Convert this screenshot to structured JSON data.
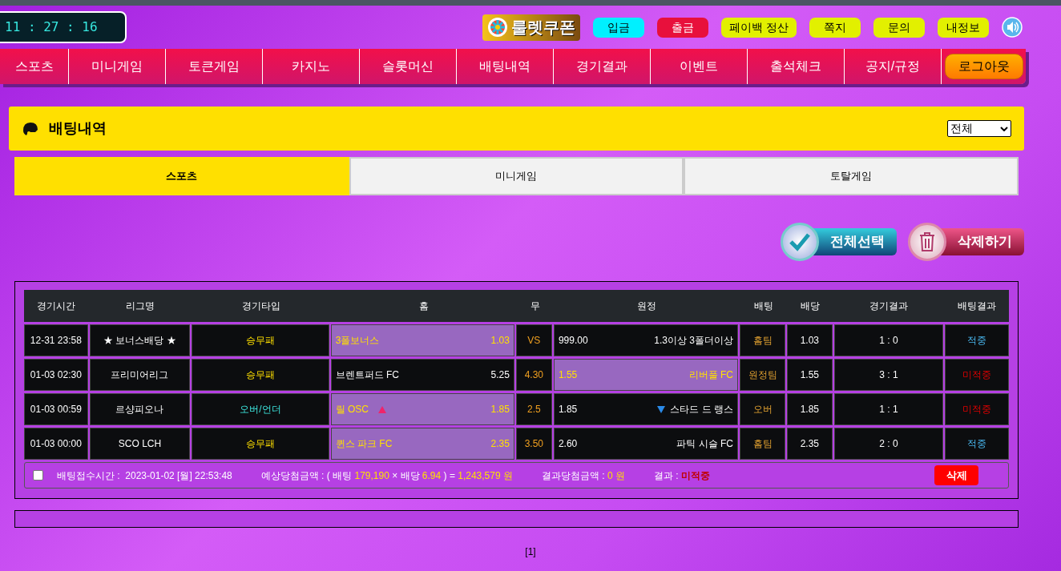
{
  "clock": "11 : 27 : 16",
  "logo": {
    "text": "룰렛쿠폰"
  },
  "top_buttons": [
    {
      "label": "입금",
      "kind": "cyan"
    },
    {
      "label": "출금",
      "kind": "red"
    },
    {
      "label": "페이백 정산",
      "kind": "lime"
    },
    {
      "label": "쪽지",
      "kind": "lime"
    },
    {
      "label": "문의",
      "kind": "lime"
    },
    {
      "label": "내정보",
      "kind": "lime"
    }
  ],
  "nav": {
    "items": [
      "스포츠",
      "미니게임",
      "토큰게임",
      "카지노",
      "슬롯머신",
      "배팅내역",
      "경기결과",
      "이벤트",
      "출석체크",
      "공지/규정"
    ],
    "logout": "로그아웃"
  },
  "section": {
    "title": "배팅내역",
    "filter": "전체"
  },
  "tabs": [
    {
      "label": "스포츠",
      "selected": true
    },
    {
      "label": "미니게임",
      "selected": false
    },
    {
      "label": "토탈게임",
      "selected": false
    }
  ],
  "actions": {
    "select_all": "전체선택",
    "delete": "삭제하기"
  },
  "table": {
    "columns": [
      "경기시간",
      "리그명",
      "경기타입",
      "홈",
      "무",
      "원정",
      "배팅",
      "배당",
      "경기결과",
      "배팅결과"
    ],
    "rows": [
      {
        "time": "12-31 23:58",
        "league": "★ 보너스배당 ★",
        "type": "승무패",
        "kind": "result",
        "home": {
          "name": "3폴보너스",
          "odds": "1.03",
          "selected": true
        },
        "draw": "VS",
        "away": {
          "odds": "999.00",
          "name": "1.3이상 3폴더이상",
          "selected": false
        },
        "bet": "홈팀",
        "rate": "1.03",
        "score": "1 : 0",
        "result": {
          "text": "적중",
          "won": true
        }
      },
      {
        "time": "01-03 02:30",
        "league": "프리미어리그",
        "type": "승무패",
        "kind": "result",
        "home": {
          "name": "브렌트퍼드 FC",
          "odds": "5.25",
          "selected": false
        },
        "draw": "4.30",
        "away": {
          "odds": "1.55",
          "name": "리버풀 FC",
          "selected": true
        },
        "bet": "원정팀",
        "rate": "1.55",
        "score": "3 : 1",
        "result": {
          "text": "미적중",
          "won": false
        }
      },
      {
        "time": "01-03 00:59",
        "league": "르샹피오나",
        "type": "오버/언더",
        "kind": "over_under",
        "home": {
          "name": "릴 OSC",
          "odds": "1.85",
          "selected": true,
          "kind": "up"
        },
        "draw": "2.5",
        "away": {
          "odds": "1.85",
          "name": "스타드 드 랭스",
          "selected": false,
          "kind": "down"
        },
        "bet": "오버",
        "rate": "1.85",
        "score": "1 : 1",
        "result": {
          "text": "미적중",
          "won": false
        }
      },
      {
        "time": "01-03 00:00",
        "league": "SCO LCH",
        "type": "승무패",
        "kind": "result",
        "home": {
          "name": "퀸스 파크 FC",
          "odds": "2.35",
          "selected": true
        },
        "draw": "3.50",
        "away": {
          "odds": "2.60",
          "name": "파틱 시슬 FC",
          "selected": false
        },
        "bet": "홈팀",
        "rate": "2.35",
        "score": "2 : 0",
        "result": {
          "text": "적중",
          "won": true
        }
      }
    ]
  },
  "summary": {
    "checked": false,
    "groups": [
      [
        {
          "text": "배팅접수시간 :  ",
          "kind": "label"
        },
        {
          "text": "2023-01-02 [월] 22:53:48",
          "kind": "value"
        }
      ],
      [
        {
          "text": "예상당첨금액 : ( 배팅 ",
          "kind": "label"
        },
        {
          "text": "179,190",
          "kind": "highlight"
        },
        {
          "text": " × 배당 ",
          "kind": "label"
        },
        {
          "text": "6.94",
          "kind": "highlight"
        },
        {
          "text": " ) = ",
          "kind": "label"
        },
        {
          "text": "1,243,579 원",
          "kind": "highlight"
        }
      ],
      [
        {
          "text": "결과당첨금액 : ",
          "kind": "label"
        },
        {
          "text": "0 원",
          "kind": "highlight"
        }
      ],
      [
        {
          "text": "결과 : ",
          "kind": "label"
        },
        {
          "text": "미적중",
          "kind": "loss"
        }
      ]
    ],
    "delete": "삭제"
  },
  "pagination": "[1]"
}
